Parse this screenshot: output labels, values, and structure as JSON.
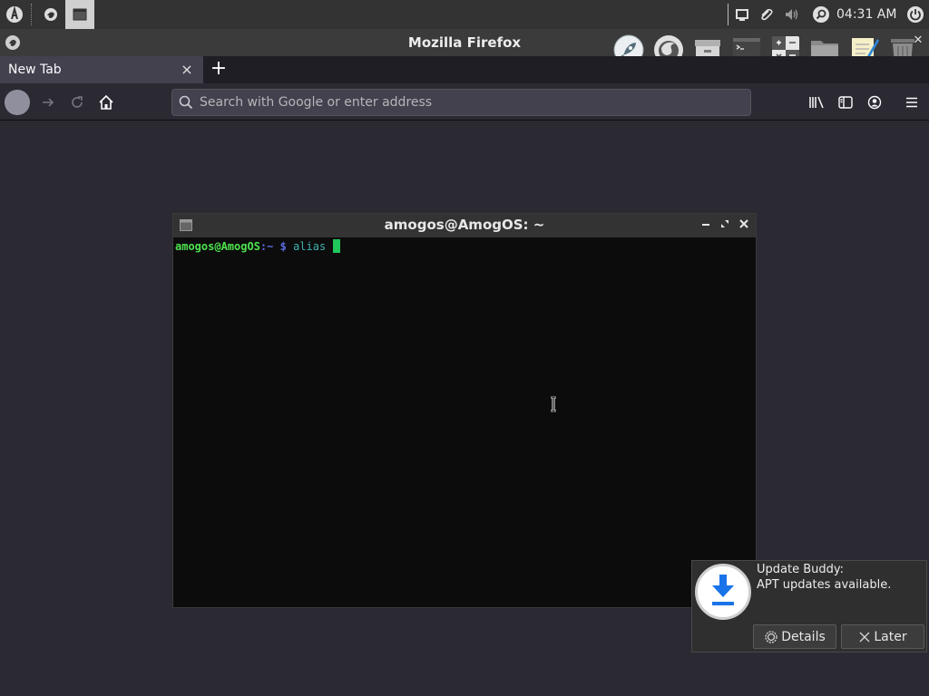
{
  "top_panel": {
    "clock": "04:31 AM"
  },
  "firefox": {
    "window_title": "Mozilla Firefox",
    "tab_label": "New Tab",
    "tab_close": "×",
    "new_tab_button": "+",
    "url_placeholder": "Search with Google or enter address"
  },
  "terminal": {
    "window_title": "amogos@AmogOS: ~",
    "prompt_user": "amogos@AmogOS",
    "prompt_path": ":~",
    "prompt_symbol": "$",
    "command": "alias"
  },
  "notification": {
    "title": "Update Buddy:",
    "body": "APT updates available.",
    "details_button": "Details",
    "later_button": "Later"
  },
  "colors": {
    "prompt_user": "#4ee24e",
    "prompt_path": "#5a6cde",
    "cursor": "#20c75a",
    "download_icon": "#1a73e8"
  },
  "dock": {
    "icons": [
      "rocket-icon",
      "firefox-icon",
      "archive-icon",
      "terminal-icon",
      "calculator-icon",
      "folder-icon",
      "text-editor-icon",
      "trash-icon"
    ]
  }
}
